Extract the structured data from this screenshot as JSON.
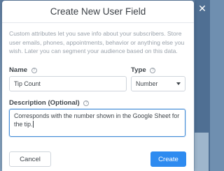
{
  "modal": {
    "title": "Create New User Field",
    "description": "Custom attributes let you save info about your subscribers. Store user emails, phones, appointments, behavior or anything else you wish. Later you can segment your audience based on this data.",
    "name_label": "Name",
    "name_value": "Tip Count",
    "type_label": "Type",
    "type_value": "Number",
    "description_label": "Description (Optional)",
    "description_value": "Corresponds with the number shown in the Google Sheet for the tip.",
    "help_glyph": "?",
    "cancel_label": "Cancel",
    "create_label": "Create"
  },
  "colors": {
    "primary_button": "#2e8bf0",
    "focus_border": "#4a90d9",
    "backdrop": "#6f8fb0"
  },
  "icons": {
    "help": "question-circle-icon",
    "dropdown": "caret-down-icon",
    "close": "close-icon"
  }
}
